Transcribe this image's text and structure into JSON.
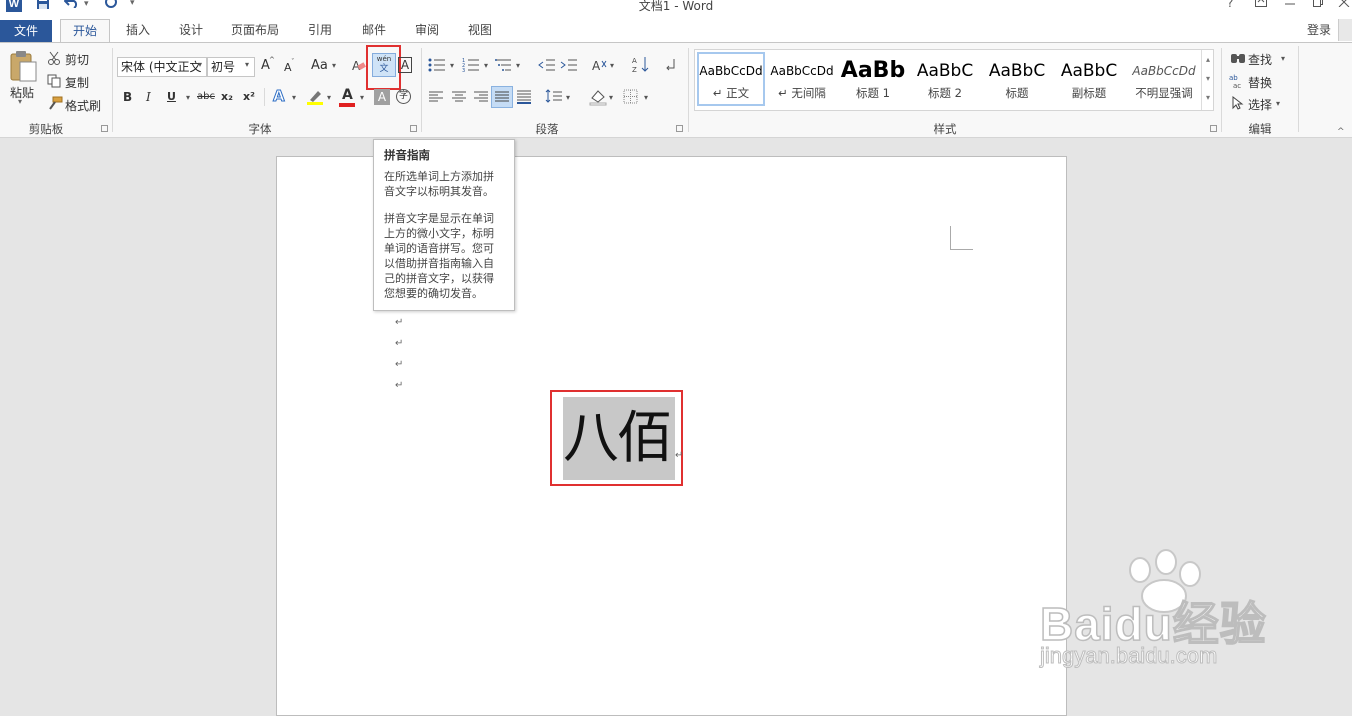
{
  "titlebar": {
    "doc_title": "文档1 - Word",
    "app_icon": "W",
    "help": "?",
    "qat_icons": [
      "save-icon",
      "undo-icon",
      "redo-icon",
      "customize-icon"
    ]
  },
  "tabs": {
    "file": "文件",
    "home": "开始",
    "insert": "插入",
    "design": "设计",
    "layout": "页面布局",
    "references": "引用",
    "mailings": "邮件",
    "review": "审阅",
    "view": "视图",
    "signin": "登录"
  },
  "clipboard": {
    "paste": "粘贴",
    "cut": "剪切",
    "copy": "复制",
    "format_painter": "格式刷",
    "label": "剪贴板"
  },
  "font": {
    "family": "宋体 (中文正文",
    "size": "初号",
    "grow": "A",
    "shrink": "A",
    "case": "Aa",
    "bold": "B",
    "italic": "I",
    "underline": "U",
    "strike": "abc",
    "subscript": "x₂",
    "superscript": "x²",
    "text_effects": "A",
    "font_color": "A",
    "char_shading": "A",
    "enclose": "字",
    "phonetic_top": "wén",
    "phonetic_bottom": "文",
    "char_border": "A",
    "label": "字体"
  },
  "paragraph": {
    "label": "段落"
  },
  "styles": {
    "label": "样式",
    "items": [
      {
        "sample": "AaBbCcDd",
        "name": "↵ 正文"
      },
      {
        "sample": "AaBbCcDd",
        "name": "↵ 无间隔"
      },
      {
        "sample": "AaBb",
        "name": "标题 1"
      },
      {
        "sample": "AaBbC",
        "name": "标题 2"
      },
      {
        "sample": "AaBbC",
        "name": "标题"
      },
      {
        "sample": "AaBbC",
        "name": "副标题"
      },
      {
        "sample": "AaBbCcDd",
        "name": "不明显强调"
      }
    ]
  },
  "editing": {
    "find": "查找",
    "replace": "替换",
    "select": "选择",
    "label": "编辑"
  },
  "tooltip": {
    "title": "拼音指南",
    "text1": "在所选单词上方添加拼音文字以标明其发音。",
    "text2": "拼音文字是显示在单词上方的微小文字，标明单词的语音拼写。您可以借助拼音指南输入自己的拼音文字，以获得您想要的确切发音。"
  },
  "document": {
    "para_mark": "↵",
    "selected_text": "八佰"
  },
  "watermark": {
    "brand": "Baidu经验",
    "url": "jingyan.baidu.com"
  },
  "colors": {
    "word_blue": "#2b579a",
    "highlight_red": "#e03030",
    "selection_gray": "#c8c8c8"
  }
}
